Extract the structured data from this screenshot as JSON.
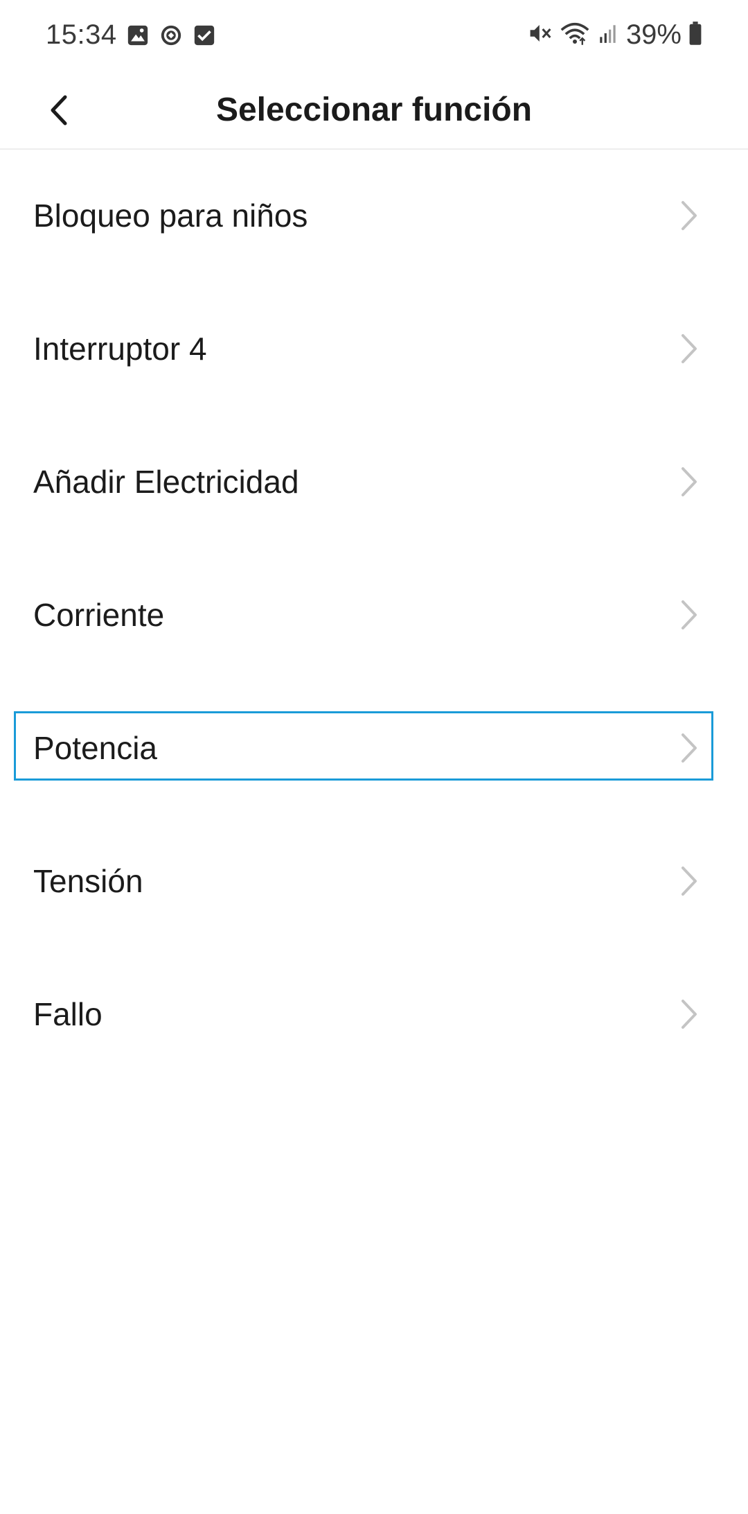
{
  "status_bar": {
    "time": "15:34",
    "left_icons": [
      "gallery-icon",
      "sync-icon",
      "checkbox-icon"
    ],
    "right_icons": [
      "mute-icon",
      "wifi-icon",
      "signal-icon",
      "battery-icon"
    ],
    "battery_percent": "39%"
  },
  "header": {
    "title": "Seleccionar función",
    "back_icon": "chevron-left-icon"
  },
  "functions": [
    {
      "label": "Bloqueo para niños"
    },
    {
      "label": "Interruptor 4"
    },
    {
      "label": "Añadir Electricidad"
    },
    {
      "label": "Corriente"
    },
    {
      "label": "Potencia",
      "selected": true
    },
    {
      "label": "Tensión"
    },
    {
      "label": "Fallo"
    }
  ],
  "colors": {
    "selection_border": "#1a9bd8",
    "chevron": "#c4c4c4",
    "text": "#1b1b1b"
  }
}
